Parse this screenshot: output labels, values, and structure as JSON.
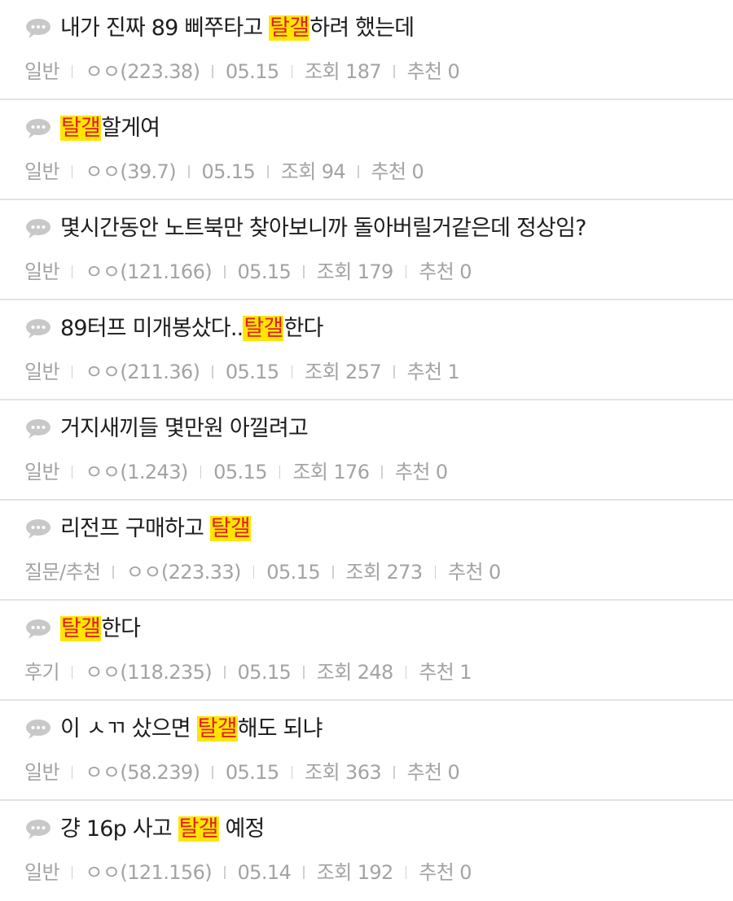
{
  "posts": [
    {
      "title_parts": [
        {
          "text": "내가 진짜 89 삐쭈타고 ",
          "hl": false
        },
        {
          "text": "탈갤",
          "hl": true
        },
        {
          "text": "하려 했는데",
          "hl": false
        }
      ],
      "category": "일반",
      "author": "ㅇㅇ(223.38)",
      "date": "05.15",
      "views": "조회 187",
      "recommend": "추천 0"
    },
    {
      "title_parts": [
        {
          "text": "탈갤",
          "hl": true
        },
        {
          "text": "할게여",
          "hl": false
        }
      ],
      "category": "일반",
      "author": "ㅇㅇ(39.7)",
      "date": "05.15",
      "views": "조회 94",
      "recommend": "추천 0"
    },
    {
      "title_parts": [
        {
          "text": "몇시간동안 노트북만 찾아보니까 돌아버릴거같은데 정상임?",
          "hl": false
        }
      ],
      "category": "일반",
      "author": "ㅇㅇ(121.166)",
      "date": "05.15",
      "views": "조회 179",
      "recommend": "추천 0"
    },
    {
      "title_parts": [
        {
          "text": "89터프 미개봉샀다..",
          "hl": false
        },
        {
          "text": "탈갤",
          "hl": true
        },
        {
          "text": "한다",
          "hl": false
        }
      ],
      "category": "일반",
      "author": "ㅇㅇ(211.36)",
      "date": "05.15",
      "views": "조회 257",
      "recommend": "추천 1"
    },
    {
      "title_parts": [
        {
          "text": "거지새끼들 몇만원 아낄려고",
          "hl": false
        }
      ],
      "category": "일반",
      "author": "ㅇㅇ(1.243)",
      "date": "05.15",
      "views": "조회 176",
      "recommend": "추천 0"
    },
    {
      "title_parts": [
        {
          "text": "리전프 구매하고 ",
          "hl": false
        },
        {
          "text": "탈갤",
          "hl": true
        }
      ],
      "category": "질문/추천",
      "author": "ㅇㅇ(223.33)",
      "date": "05.15",
      "views": "조회 273",
      "recommend": "추천 0"
    },
    {
      "title_parts": [
        {
          "text": "탈갤",
          "hl": true
        },
        {
          "text": "한다",
          "hl": false
        }
      ],
      "category": "후기",
      "author": "ㅇㅇ(118.235)",
      "date": "05.15",
      "views": "조회 248",
      "recommend": "추천 1"
    },
    {
      "title_parts": [
        {
          "text": "이 ㅅㄲ 샀으면 ",
          "hl": false
        },
        {
          "text": "탈갤",
          "hl": true
        },
        {
          "text": "해도 되냐",
          "hl": false
        }
      ],
      "category": "일반",
      "author": "ㅇㅇ(58.239)",
      "date": "05.15",
      "views": "조회 363",
      "recommend": "추천 0"
    },
    {
      "title_parts": [
        {
          "text": "걍 16p 사고 ",
          "hl": false
        },
        {
          "text": "탈갤",
          "hl": true
        },
        {
          "text": " 예정",
          "hl": false
        }
      ],
      "category": "일반",
      "author": "ㅇㅇ(121.156)",
      "date": "05.14",
      "views": "조회 192",
      "recommend": "추천 0"
    }
  ],
  "icon": "speech-bubble-icon",
  "colors": {
    "highlight_bg": "#ffe500",
    "highlight_text": "#e0202a",
    "title_text": "#1d1d1d",
    "meta_text": "#a3a3a3",
    "divider": "#e3e3e3"
  }
}
